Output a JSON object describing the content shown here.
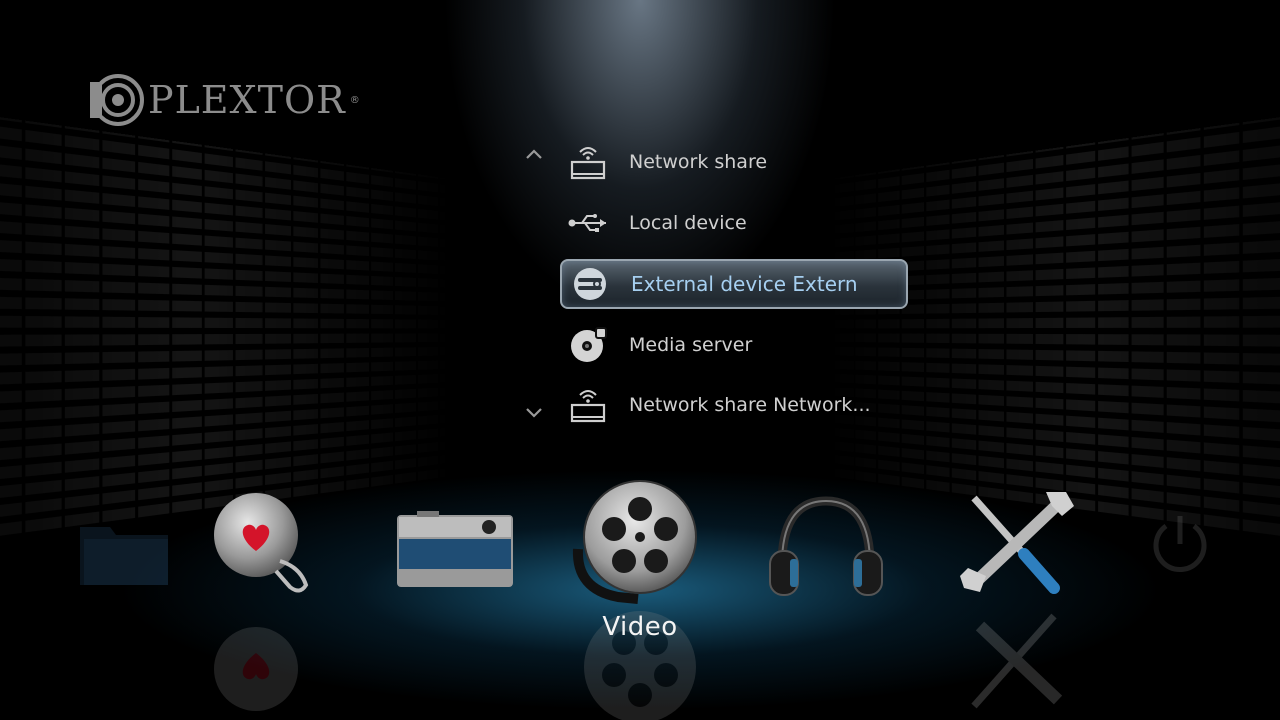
{
  "brand": {
    "name": "PLEXTOR",
    "registered": "®"
  },
  "sources": {
    "items": [
      {
        "label": "Network share",
        "icon": "network-share-icon"
      },
      {
        "label": "Local device",
        "icon": "usb-icon"
      },
      {
        "label": "External device Extern",
        "icon": "external-device-icon",
        "selected": true
      },
      {
        "label": "Media server",
        "icon": "media-server-icon"
      },
      {
        "label": "Network share Network...",
        "icon": "network-share-icon"
      }
    ]
  },
  "categories": {
    "items": [
      {
        "name": "Folder",
        "icon": "folder-icon"
      },
      {
        "name": "Favorites",
        "icon": "favorites-icon"
      },
      {
        "name": "Photo",
        "icon": "camera-icon"
      },
      {
        "name": "Video",
        "icon": "film-reel-icon",
        "selected": true
      },
      {
        "name": "Music",
        "icon": "headphones-icon"
      },
      {
        "name": "Settings",
        "icon": "tools-icon"
      },
      {
        "name": "Power",
        "icon": "power-icon"
      }
    ],
    "selected_label": "Video"
  },
  "colors": {
    "highlight_text": "#a6cff0",
    "accent_glow": "#2a8cc0"
  }
}
